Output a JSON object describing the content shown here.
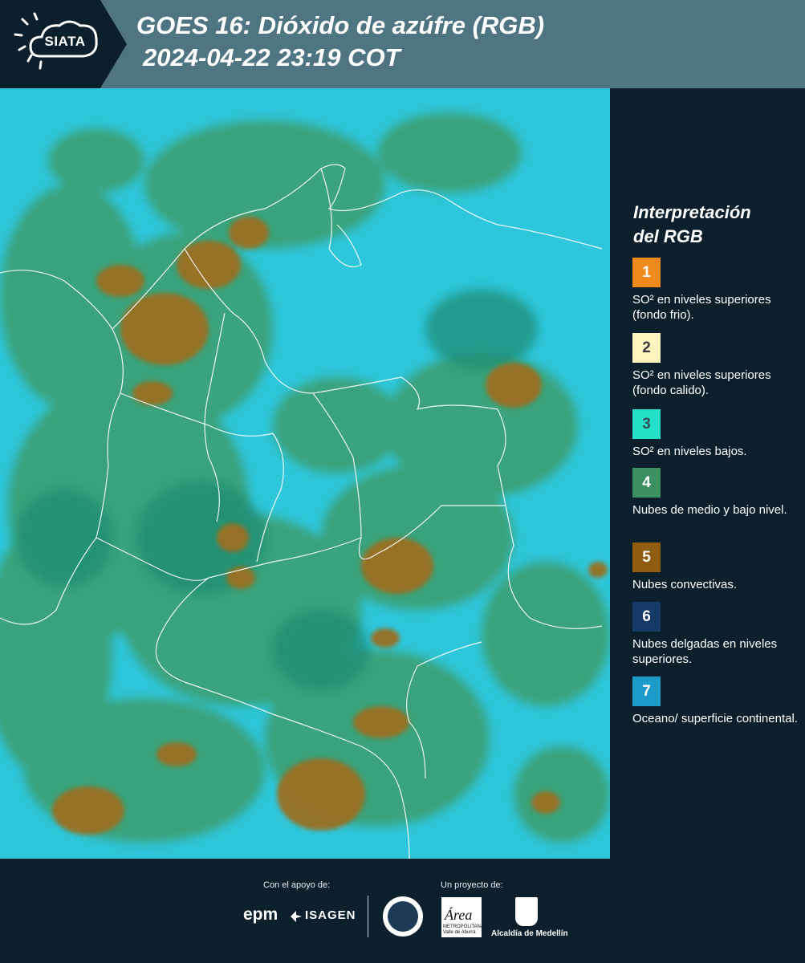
{
  "header": {
    "logo_text": "SIATA",
    "title_line1": "GOES 16: Dióxido de azúfre (RGB)",
    "title_line2": "2024-04-22 23:19 COT"
  },
  "legend": {
    "title_line1": "Interpretación",
    "title_line2": "del RGB",
    "items": [
      {
        "number": "1",
        "color": "#f08a1c",
        "number_color": "#ffffff",
        "label": "SO² en niveles superiores (fondo frio)."
      },
      {
        "number": "2",
        "color": "#fdf3bf",
        "number_color": "#3b3b3b",
        "label": "SO² en niveles superiores (fondo calido)."
      },
      {
        "number": "3",
        "color": "#27e0c8",
        "number_color": "#2f4f55",
        "label": "SO² en niveles bajos."
      },
      {
        "number": "4",
        "color": "#3c8f60",
        "number_color": "#ffffff",
        "label": "Nubes de medio y bajo nivel."
      },
      {
        "number": "5",
        "color": "#8f5d12",
        "number_color": "#ffffff",
        "label": "Nubes convectivas."
      },
      {
        "number": "6",
        "color": "#163a66",
        "number_color": "#ffffff",
        "label": "Nubes delgadas en niveles superiores."
      },
      {
        "number": "7",
        "color": "#1d9bc8",
        "number_color": "#ffffff",
        "label": "Oceano/ superficie continental."
      }
    ]
  },
  "footer": {
    "support_caption": "Con el apoyo de:",
    "project_caption": "Un proyecto de:",
    "sponsor_1": "epm",
    "sponsor_2": "ISAGEN",
    "partner_area": "Área",
    "partner_area_sub": "METROPOLITANA Valle de Aburrá",
    "partner_alcaldia": "Alcaldía de Medellín"
  },
  "map": {
    "background_color": "#2bc3d8",
    "cloud_colors": [
      "#3a9a6a",
      "#8f6a22",
      "#5ab07a",
      "#1f7f6f"
    ]
  }
}
